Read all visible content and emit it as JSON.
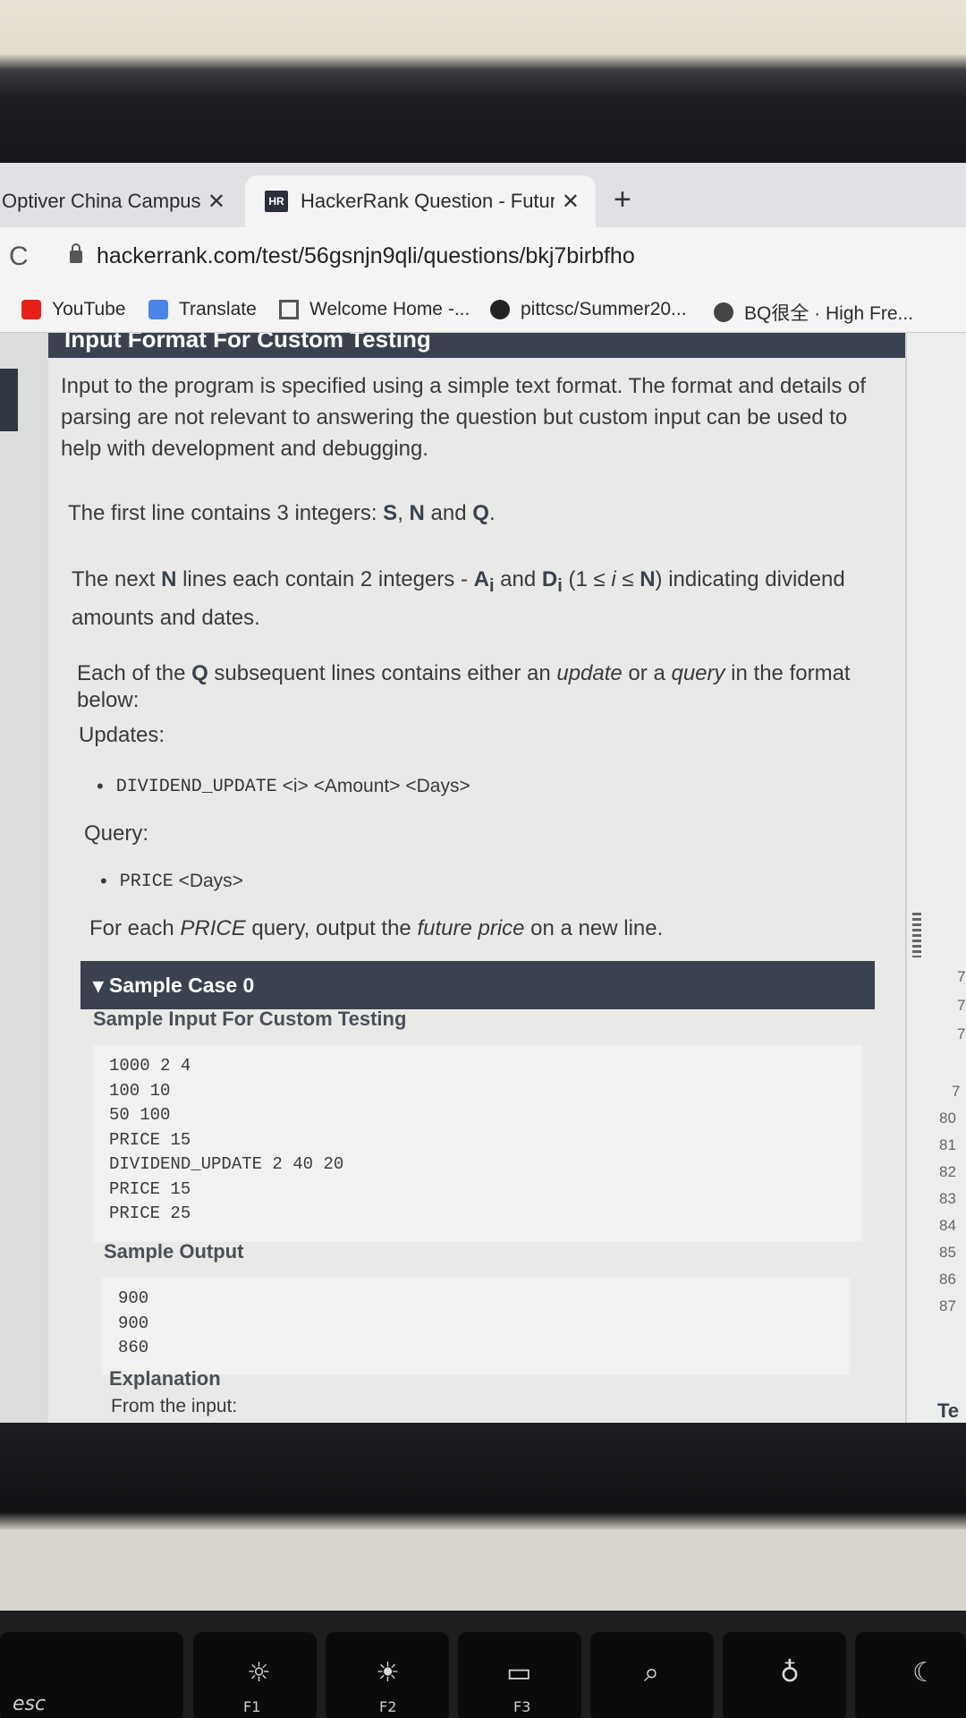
{
  "browser": {
    "tabs": [
      {
        "label": "Optiver China Campus O",
        "active": false
      },
      {
        "label": "HackerRank Question - Future",
        "active": true
      }
    ],
    "tab_close_glyph": "✕",
    "hr_favicon": "HR",
    "newtab_glyph": "+",
    "reload_glyph": "C",
    "url": "hackerrank.com/test/56gsnjn9qli/questions/bkj7birbfho",
    "bookmarks": [
      {
        "label": "YouTube",
        "icon": "youtube-icon",
        "color": "#e62117"
      },
      {
        "label": "Translate",
        "icon": "translate-icon",
        "color": "#4a84e8"
      },
      {
        "label": "Welcome Home -...",
        "icon": "arrow-logo-icon",
        "color": "#555555"
      },
      {
        "label": "pittcsc/Summer20...",
        "icon": "github-icon",
        "color": "#222222"
      },
      {
        "label": "BQ很全 · High Fre...",
        "icon": "globe-icon",
        "color": "#444444"
      }
    ]
  },
  "problem": {
    "section_title": "Input Format For Custom Testing",
    "p1": "Input to the program is specified using a simple text format. The format and details of parsing are not relevant to answering the question but custom input can be used to help with development and debugging.",
    "p2_pre": "The first line contains 3 integers: ",
    "p2_s": "S",
    "p2_sep1": ", ",
    "p2_n": "N",
    "p2_and": " and ",
    "p2_q": "Q",
    "p2_end": ".",
    "p3_pre": "The next ",
    "p3_n": "N",
    "p3_mid": " lines each contain 2 integers - ",
    "p3_a": "A",
    "p3_and": " and ",
    "p3_d": "D",
    "p3_range_pre": " (1 ≤ ",
    "p3_i": "i",
    "p3_range_mid": " ≤ ",
    "p3_range_n": "N",
    "p3_rest": ") indicating dividend amounts and dates.",
    "p4_pre": "Each of the ",
    "p4_q": "Q",
    "p4_mid": " subsequent lines contains either an ",
    "p4_update": "update",
    "p4_or": " or a ",
    "p4_query": "query",
    "p4_end": " in the format below:",
    "updates_label": "Updates:",
    "update_cmd": "DIVIDEND_UPDATE",
    "update_args": "<i> <Amount> <Days>",
    "query_label": "Query:",
    "query_cmd": "PRICE",
    "query_args": "<Days>",
    "p5_pre": "For each ",
    "p5_price": "PRICE",
    "p5_mid": " query, output the ",
    "p5_future": "future price",
    "p5_end": " on a new line."
  },
  "sample": {
    "header": "▾ Sample Case 0",
    "input_title": "Sample Input For Custom Testing",
    "input_lines": [
      "1000 2 4",
      "100 10",
      "50 100",
      "PRICE 15",
      "DIVIDEND_UPDATE 2 40 20",
      "PRICE 15",
      "PRICE 25"
    ],
    "output_title": "Sample Output",
    "output_lines": [
      "900",
      "900",
      "860"
    ],
    "explanation_title": "Explanation",
    "explanation_text": "From the input:"
  },
  "editor": {
    "line_numbers": [
      "7",
      "7",
      "7",
      "7",
      "80",
      "81",
      "82",
      "83",
      "84",
      "85",
      "86",
      "87"
    ],
    "right_label": "Te"
  },
  "keyboard": {
    "esc": "esc",
    "f1": "F1",
    "f2": "F2",
    "f3": "F3"
  }
}
